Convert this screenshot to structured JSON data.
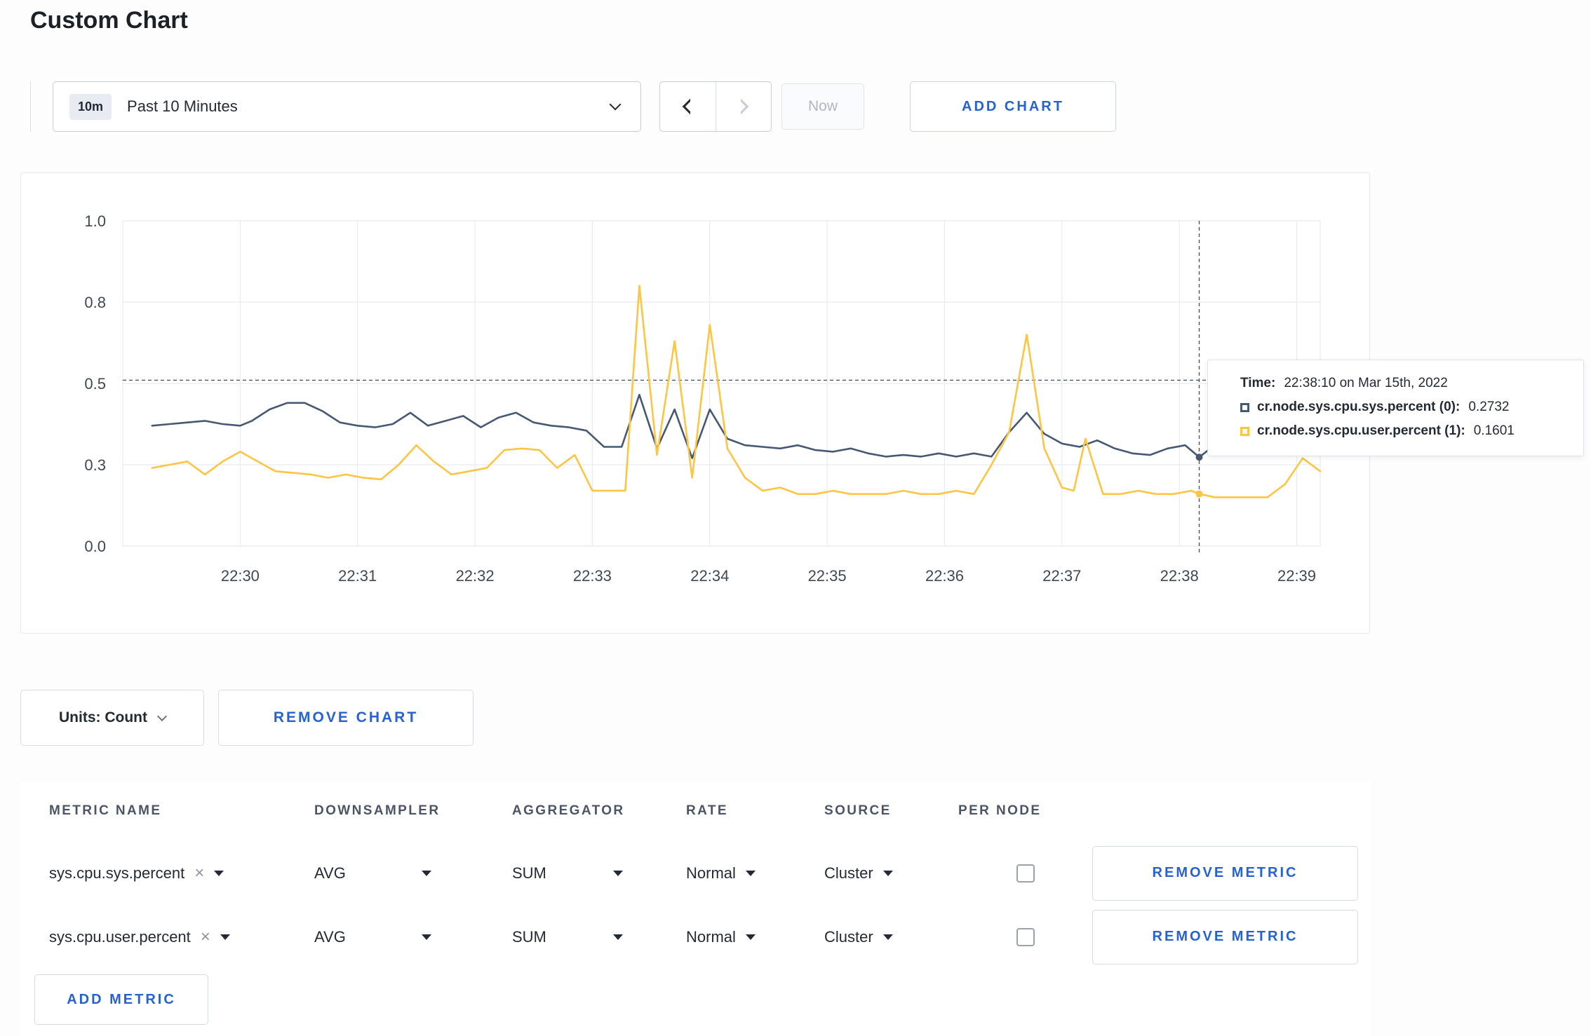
{
  "page": {
    "title": "Custom Chart"
  },
  "toolbar": {
    "time_badge": "10m",
    "time_label": "Past 10 Minutes",
    "now_label": "Now",
    "add_chart_label": "ADD CHART"
  },
  "chart_data": {
    "type": "line",
    "title": "",
    "x_unit": "minutes after 22:00 on Mar 15th, 2022",
    "x_range": [
      29.0,
      39.2
    ],
    "ylim": [
      0,
      1
    ],
    "grid": true,
    "y_ticks": [
      {
        "v": 0,
        "label": "0.0"
      },
      {
        "v": 0.25,
        "label": "0.3"
      },
      {
        "v": 0.5,
        "label": "0.5"
      },
      {
        "v": 0.75,
        "label": "0.8"
      },
      {
        "v": 1,
        "label": "1.0"
      }
    ],
    "x_ticks": [
      {
        "v": 30,
        "label": "22:30"
      },
      {
        "v": 31,
        "label": "22:31"
      },
      {
        "v": 32,
        "label": "22:32"
      },
      {
        "v": 33,
        "label": "22:33"
      },
      {
        "v": 34,
        "label": "22:34"
      },
      {
        "v": 35,
        "label": "22:35"
      },
      {
        "v": 36,
        "label": "22:36"
      },
      {
        "v": 37,
        "label": "22:37"
      },
      {
        "v": 38,
        "label": "22:38"
      },
      {
        "v": 39,
        "label": "22:39"
      }
    ],
    "series": [
      {
        "name": "cr.node.sys.cpu.sys.percent",
        "color": "#475872",
        "points": [
          [
            29.25,
            0.37
          ],
          [
            29.4,
            0.375
          ],
          [
            29.55,
            0.38
          ],
          [
            29.7,
            0.385
          ],
          [
            29.85,
            0.375
          ],
          [
            30.0,
            0.37
          ],
          [
            30.1,
            0.385
          ],
          [
            30.25,
            0.42
          ],
          [
            30.4,
            0.44
          ],
          [
            30.55,
            0.44
          ],
          [
            30.7,
            0.415
          ],
          [
            30.85,
            0.38
          ],
          [
            31.0,
            0.37
          ],
          [
            31.15,
            0.365
          ],
          [
            31.3,
            0.375
          ],
          [
            31.45,
            0.41
          ],
          [
            31.6,
            0.37
          ],
          [
            31.75,
            0.385
          ],
          [
            31.9,
            0.4
          ],
          [
            32.05,
            0.365
          ],
          [
            32.2,
            0.395
          ],
          [
            32.35,
            0.41
          ],
          [
            32.5,
            0.38
          ],
          [
            32.65,
            0.37
          ],
          [
            32.8,
            0.365
          ],
          [
            32.95,
            0.355
          ],
          [
            33.1,
            0.305
          ],
          [
            33.25,
            0.305
          ],
          [
            33.4,
            0.465
          ],
          [
            33.55,
            0.3
          ],
          [
            33.7,
            0.42
          ],
          [
            33.85,
            0.27
          ],
          [
            34.0,
            0.42
          ],
          [
            34.15,
            0.33
          ],
          [
            34.3,
            0.31
          ],
          [
            34.45,
            0.305
          ],
          [
            34.6,
            0.3
          ],
          [
            34.75,
            0.31
          ],
          [
            34.9,
            0.295
          ],
          [
            35.05,
            0.29
          ],
          [
            35.2,
            0.3
          ],
          [
            35.35,
            0.285
          ],
          [
            35.5,
            0.275
          ],
          [
            35.65,
            0.28
          ],
          [
            35.8,
            0.275
          ],
          [
            35.95,
            0.285
          ],
          [
            36.1,
            0.275
          ],
          [
            36.25,
            0.285
          ],
          [
            36.4,
            0.275
          ],
          [
            36.55,
            0.35
          ],
          [
            36.7,
            0.41
          ],
          [
            36.85,
            0.345
          ],
          [
            37.0,
            0.315
          ],
          [
            37.15,
            0.305
          ],
          [
            37.3,
            0.325
          ],
          [
            37.45,
            0.3
          ],
          [
            37.6,
            0.285
          ],
          [
            37.75,
            0.28
          ],
          [
            37.9,
            0.3
          ],
          [
            38.05,
            0.31
          ],
          [
            38.17,
            0.2732
          ],
          [
            38.3,
            0.31
          ],
          [
            38.45,
            0.3
          ],
          [
            38.6,
            0.3
          ],
          [
            38.75,
            0.315
          ],
          [
            38.9,
            0.32
          ],
          [
            39.05,
            0.3
          ],
          [
            39.2,
            0.31
          ]
        ]
      },
      {
        "name": "cr.node.sys.cpu.user.percent",
        "color": "#fdc543",
        "points": [
          [
            29.25,
            0.24
          ],
          [
            29.4,
            0.25
          ],
          [
            29.55,
            0.26
          ],
          [
            29.7,
            0.22
          ],
          [
            29.85,
            0.26
          ],
          [
            30.0,
            0.29
          ],
          [
            30.15,
            0.26
          ],
          [
            30.3,
            0.23
          ],
          [
            30.45,
            0.225
          ],
          [
            30.6,
            0.22
          ],
          [
            30.75,
            0.21
          ],
          [
            30.9,
            0.22
          ],
          [
            31.05,
            0.21
          ],
          [
            31.2,
            0.205
          ],
          [
            31.35,
            0.25
          ],
          [
            31.5,
            0.31
          ],
          [
            31.65,
            0.26
          ],
          [
            31.8,
            0.22
          ],
          [
            31.95,
            0.23
          ],
          [
            32.1,
            0.24
          ],
          [
            32.25,
            0.295
          ],
          [
            32.4,
            0.3
          ],
          [
            32.55,
            0.295
          ],
          [
            32.7,
            0.24
          ],
          [
            32.85,
            0.28
          ],
          [
            33.0,
            0.17
          ],
          [
            33.15,
            0.17
          ],
          [
            33.28,
            0.17
          ],
          [
            33.4,
            0.8
          ],
          [
            33.55,
            0.28
          ],
          [
            33.7,
            0.63
          ],
          [
            33.85,
            0.21
          ],
          [
            34.0,
            0.68
          ],
          [
            34.15,
            0.3
          ],
          [
            34.3,
            0.21
          ],
          [
            34.45,
            0.17
          ],
          [
            34.6,
            0.18
          ],
          [
            34.75,
            0.16
          ],
          [
            34.9,
            0.16
          ],
          [
            35.05,
            0.17
          ],
          [
            35.2,
            0.16
          ],
          [
            35.35,
            0.16
          ],
          [
            35.5,
            0.16
          ],
          [
            35.65,
            0.17
          ],
          [
            35.8,
            0.16
          ],
          [
            35.95,
            0.16
          ],
          [
            36.1,
            0.17
          ],
          [
            36.25,
            0.16
          ],
          [
            36.4,
            0.25
          ],
          [
            36.55,
            0.35
          ],
          [
            36.7,
            0.65
          ],
          [
            36.85,
            0.3
          ],
          [
            37.0,
            0.18
          ],
          [
            37.1,
            0.17
          ],
          [
            37.2,
            0.33
          ],
          [
            37.35,
            0.16
          ],
          [
            37.5,
            0.16
          ],
          [
            37.65,
            0.17
          ],
          [
            37.8,
            0.16
          ],
          [
            37.95,
            0.16
          ],
          [
            38.1,
            0.17
          ],
          [
            38.17,
            0.1601
          ],
          [
            38.3,
            0.15
          ],
          [
            38.45,
            0.15
          ],
          [
            38.6,
            0.15
          ],
          [
            38.75,
            0.15
          ],
          [
            38.9,
            0.19
          ],
          [
            39.05,
            0.27
          ],
          [
            39.2,
            0.23
          ]
        ]
      }
    ],
    "crosshair": {
      "t": 38.169,
      "value_line": 0.51
    },
    "markers": [
      [
        38.169,
        0.2732
      ],
      [
        38.169,
        0.1601
      ]
    ]
  },
  "tooltip": {
    "time_label": "Time:",
    "time_value": "22:38:10 on Mar 15th, 2022",
    "rows": [
      {
        "label": "cr.node.sys.cpu.sys.percent (0):",
        "value": "0.2732",
        "color": "#475872"
      },
      {
        "label": "cr.node.sys.cpu.user.percent (1):",
        "value": "0.1601",
        "color": "#fdc543"
      }
    ]
  },
  "chart_footer": {
    "units_label": "Units: Count",
    "remove_chart_label": "REMOVE CHART"
  },
  "metrics_table": {
    "headers": [
      "METRIC NAME",
      "DOWNSAMPLER",
      "AGGREGATOR",
      "RATE",
      "SOURCE",
      "PER NODE"
    ],
    "rows": [
      {
        "metric": "sys.cpu.sys.percent",
        "downsampler": "AVG",
        "aggregator": "SUM",
        "rate": "Normal",
        "source": "Cluster",
        "per_node": false,
        "remove_label": "REMOVE METRIC"
      },
      {
        "metric": "sys.cpu.user.percent",
        "downsampler": "AVG",
        "aggregator": "SUM",
        "rate": "Normal",
        "source": "Cluster",
        "per_node": false,
        "remove_label": "REMOVE METRIC"
      }
    ],
    "add_metric_label": "ADD METRIC"
  },
  "colors": {
    "accent": "#2562d4",
    "grid": "#e8ebf0",
    "crosshair": "#4a5568"
  }
}
